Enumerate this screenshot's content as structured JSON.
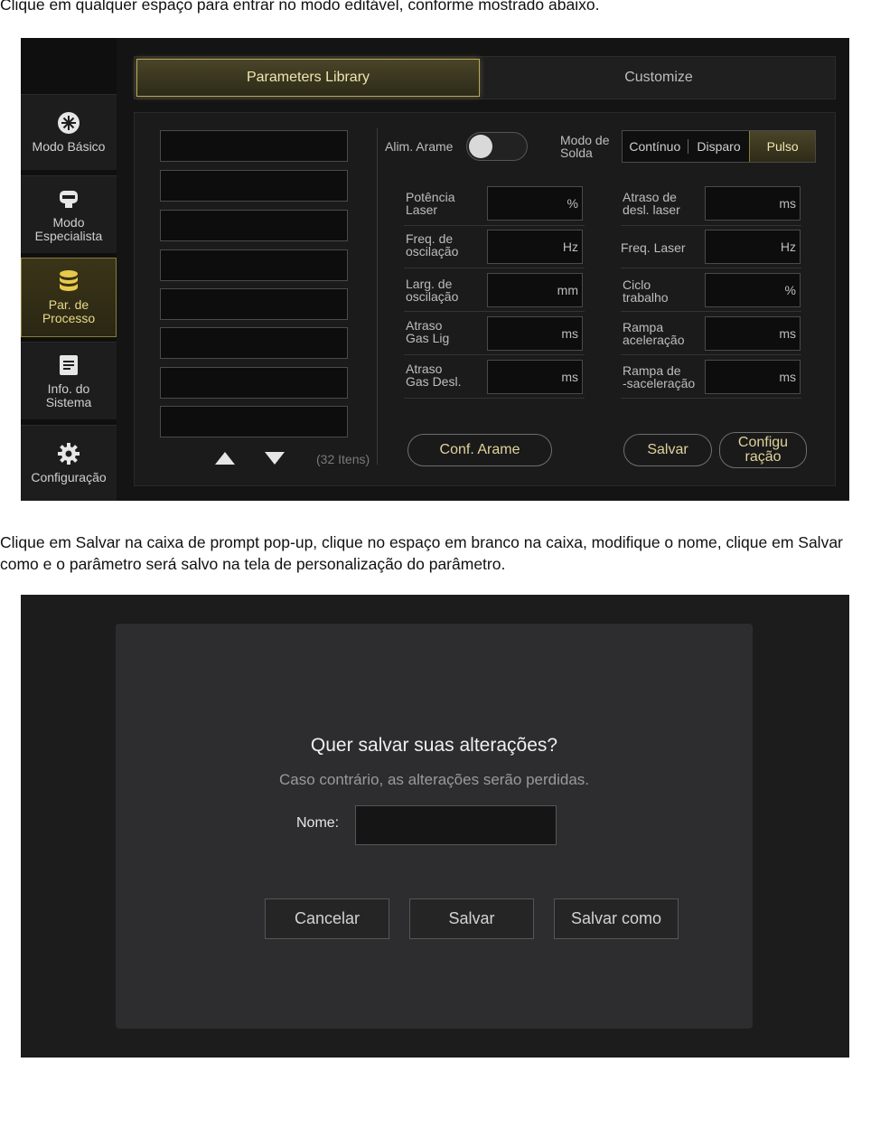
{
  "doc": {
    "intro": "Clique em qualquer espaço para entrar no modo editável, conforme mostrado abaixo.",
    "instruction": "Clique em Salvar na caixa de prompt pop-up, clique no espaço em branco na caixa, modifique o nome, clique em Salvar como e o parâmetro será salvo na tela de personalização do parâmetro."
  },
  "screen1": {
    "sidebar": {
      "items": [
        {
          "label": "Modo Básico",
          "icon": "snowflake-icon"
        },
        {
          "label": "Modo\nEspecialista",
          "icon": "helmet-icon"
        },
        {
          "label": "Par. de\nProcesso",
          "icon": "database-icon",
          "active": true
        },
        {
          "label": "Info. do\nSistema",
          "icon": "document-icon"
        },
        {
          "label": "Configuração",
          "icon": "gear-icon"
        }
      ]
    },
    "tabs": {
      "library": "Parameters Library",
      "customize": "Customize"
    },
    "list": {
      "count_label": "(32 Itens)"
    },
    "controls": {
      "wire_feed_label": "Alim. Arame",
      "weld_mode_label": "Modo de\nSolda",
      "modes": [
        "Contínuo",
        "Disparo",
        "Pulso"
      ],
      "selected_mode": "Pulso"
    },
    "params_left": [
      {
        "label": "Potência\nLaser",
        "unit": "%"
      },
      {
        "label": "Freq. de\noscilação",
        "unit": "Hz"
      },
      {
        "label": "Larg. de\noscilação",
        "unit": "mm"
      },
      {
        "label": "Atraso\nGas Lig",
        "unit": "ms"
      },
      {
        "label": "Atraso\nGas Desl.",
        "unit": "ms"
      }
    ],
    "params_right": [
      {
        "label": "Atraso de\ndesl. laser",
        "unit": "ms"
      },
      {
        "label": "Freq. Laser",
        "unit": "Hz"
      },
      {
        "label": "Ciclo\ntrabalho",
        "unit": "%"
      },
      {
        "label": "Rampa\naceleração",
        "unit": "ms"
      },
      {
        "label": "Rampa de\n-saceleração",
        "unit": "ms"
      }
    ],
    "buttons": {
      "wire_config": "Conf. Arame",
      "save": "Salvar",
      "config": "Configu\nração"
    },
    "colors": {
      "accent_gold": "#e8d98a",
      "bg": "#141414"
    }
  },
  "screen2": {
    "title": "Quer salvar suas alterações?",
    "subtitle": "Caso contrário, as alterações serão perdidas.",
    "name_label": "Nome:",
    "name_value": "",
    "buttons": {
      "cancel": "Cancelar",
      "save": "Salvar",
      "save_as": "Salvar como"
    }
  }
}
